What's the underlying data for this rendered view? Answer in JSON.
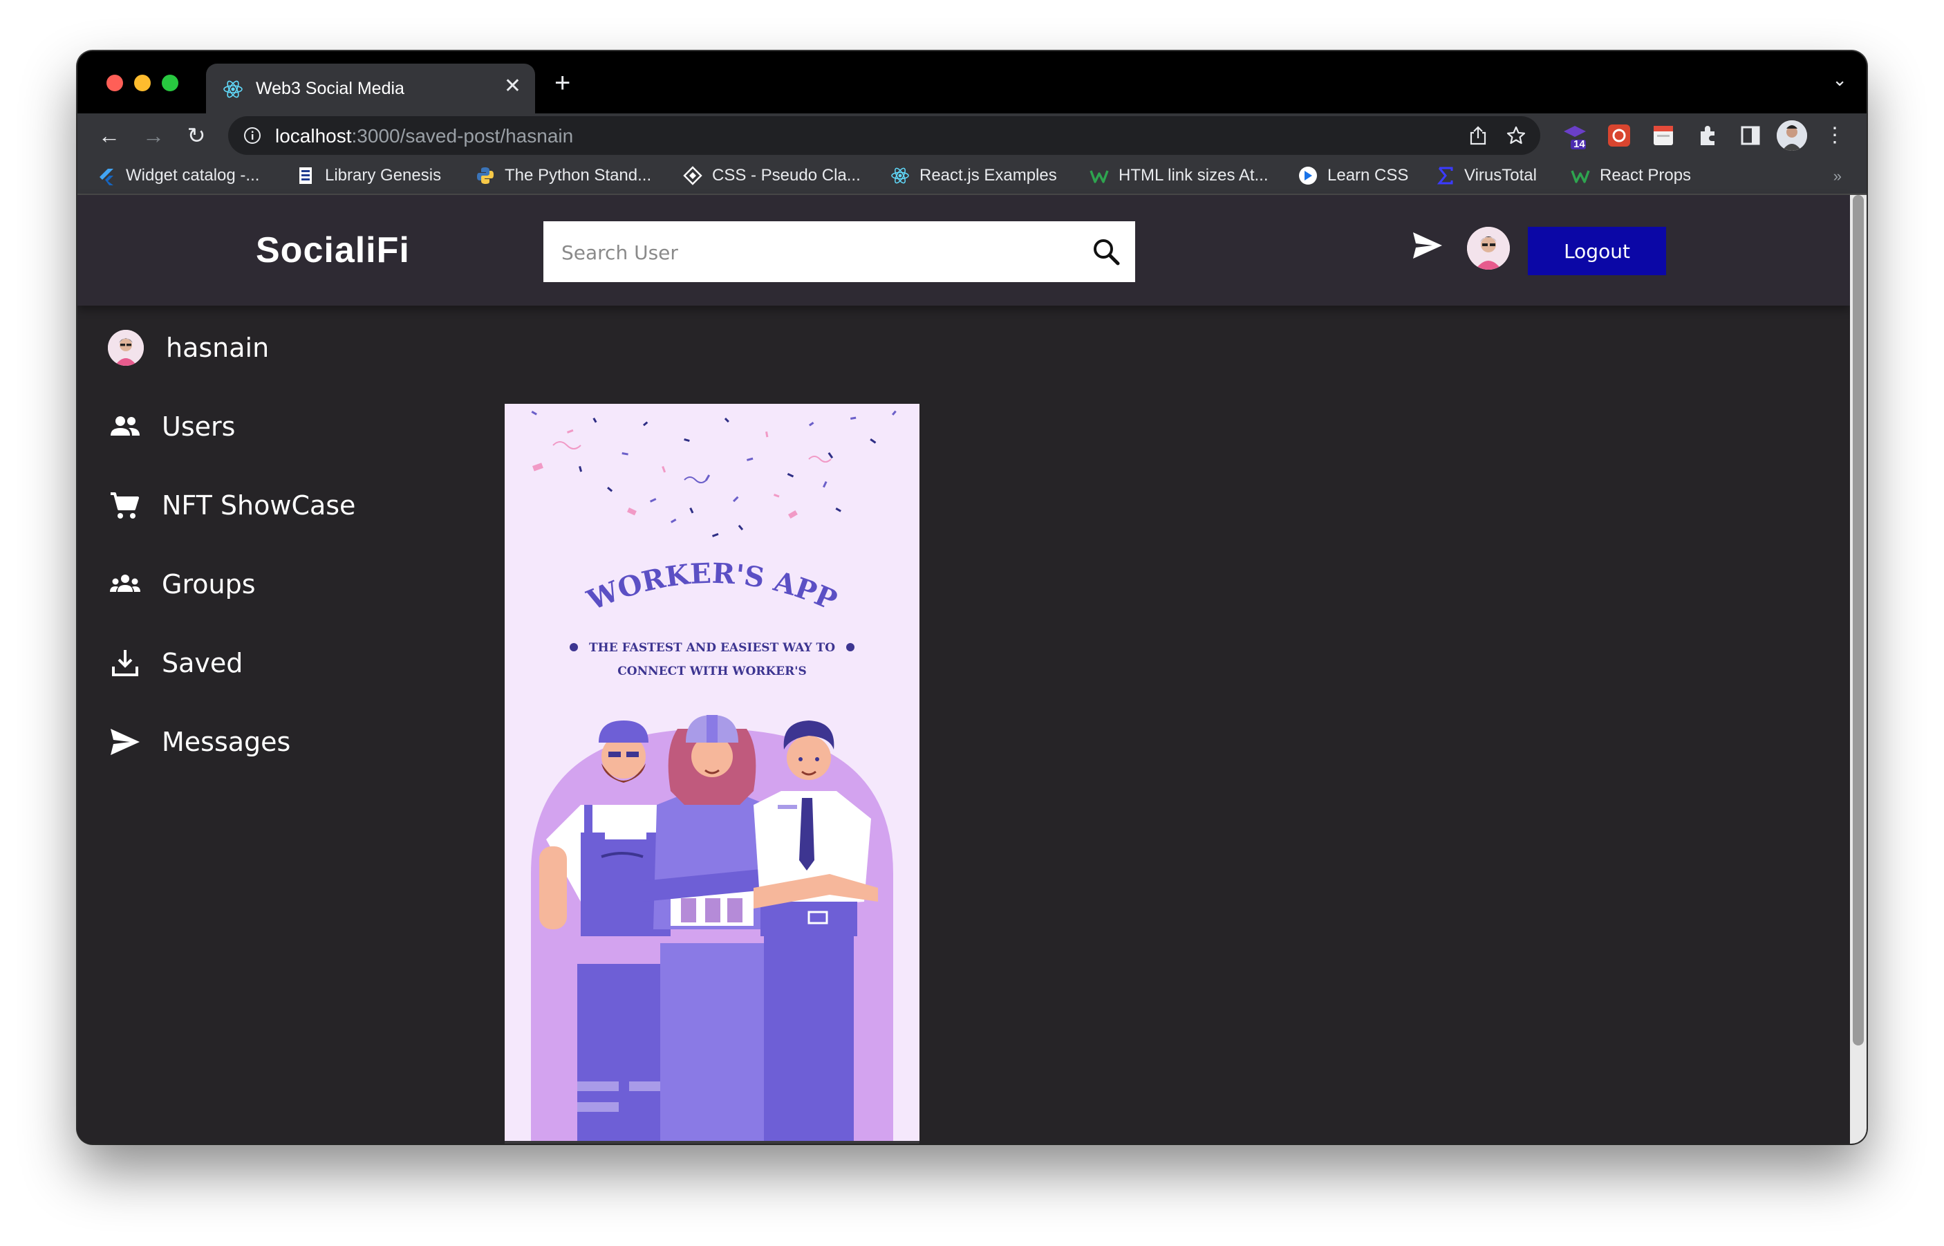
{
  "browser": {
    "tab_title": "Web3 Social Media",
    "url_host": "localhost",
    "url_path": ":3000/saved-post/hasnain",
    "extension_badge": "14",
    "bookmarks": [
      {
        "label": "Widget catalog -...",
        "icon": "flutter-icon",
        "color": "#42a5f5"
      },
      {
        "label": "Library Genesis",
        "icon": "book-icon",
        "color": "#ffffff"
      },
      {
        "label": "The Python Stand...",
        "icon": "python-icon",
        "color": "#f7c948"
      },
      {
        "label": "CSS - Pseudo Cla...",
        "icon": "css-icon",
        "color": "#ffffff"
      },
      {
        "label": "React.js Examples",
        "icon": "react-icon",
        "color": "#61dafb"
      },
      {
        "label": "HTML link sizes At...",
        "icon": "w-icon",
        "color": "#2ea44f"
      },
      {
        "label": "Learn CSS",
        "icon": "learn-icon",
        "color": "#1a73e8"
      },
      {
        "label": "VirusTotal",
        "icon": "sigma-icon",
        "color": "#3b3bff"
      },
      {
        "label": "React Props",
        "icon": "w-icon",
        "color": "#2ea44f"
      }
    ]
  },
  "app": {
    "brand": "SocialiFi",
    "search_placeholder": "Search User",
    "logout_label": "Logout",
    "accent": "#0b07a6",
    "delete_color": "#e8231b"
  },
  "sidebar": {
    "items": [
      {
        "label": "hasnain",
        "icon": "avatar"
      },
      {
        "label": "Users",
        "icon": "people-icon"
      },
      {
        "label": "NFT ShowCase",
        "icon": "cart-icon"
      },
      {
        "label": "Groups",
        "icon": "groups-icon"
      },
      {
        "label": "Saved",
        "icon": "download-icon"
      },
      {
        "label": "Messages",
        "icon": "send-icon"
      }
    ]
  },
  "post": {
    "title": "WORKER'S APP",
    "subtitle_line1": "THE FASTEST AND EASIEST WAY TO",
    "subtitle_line2": "CONNECT WITH WORKER'S"
  }
}
